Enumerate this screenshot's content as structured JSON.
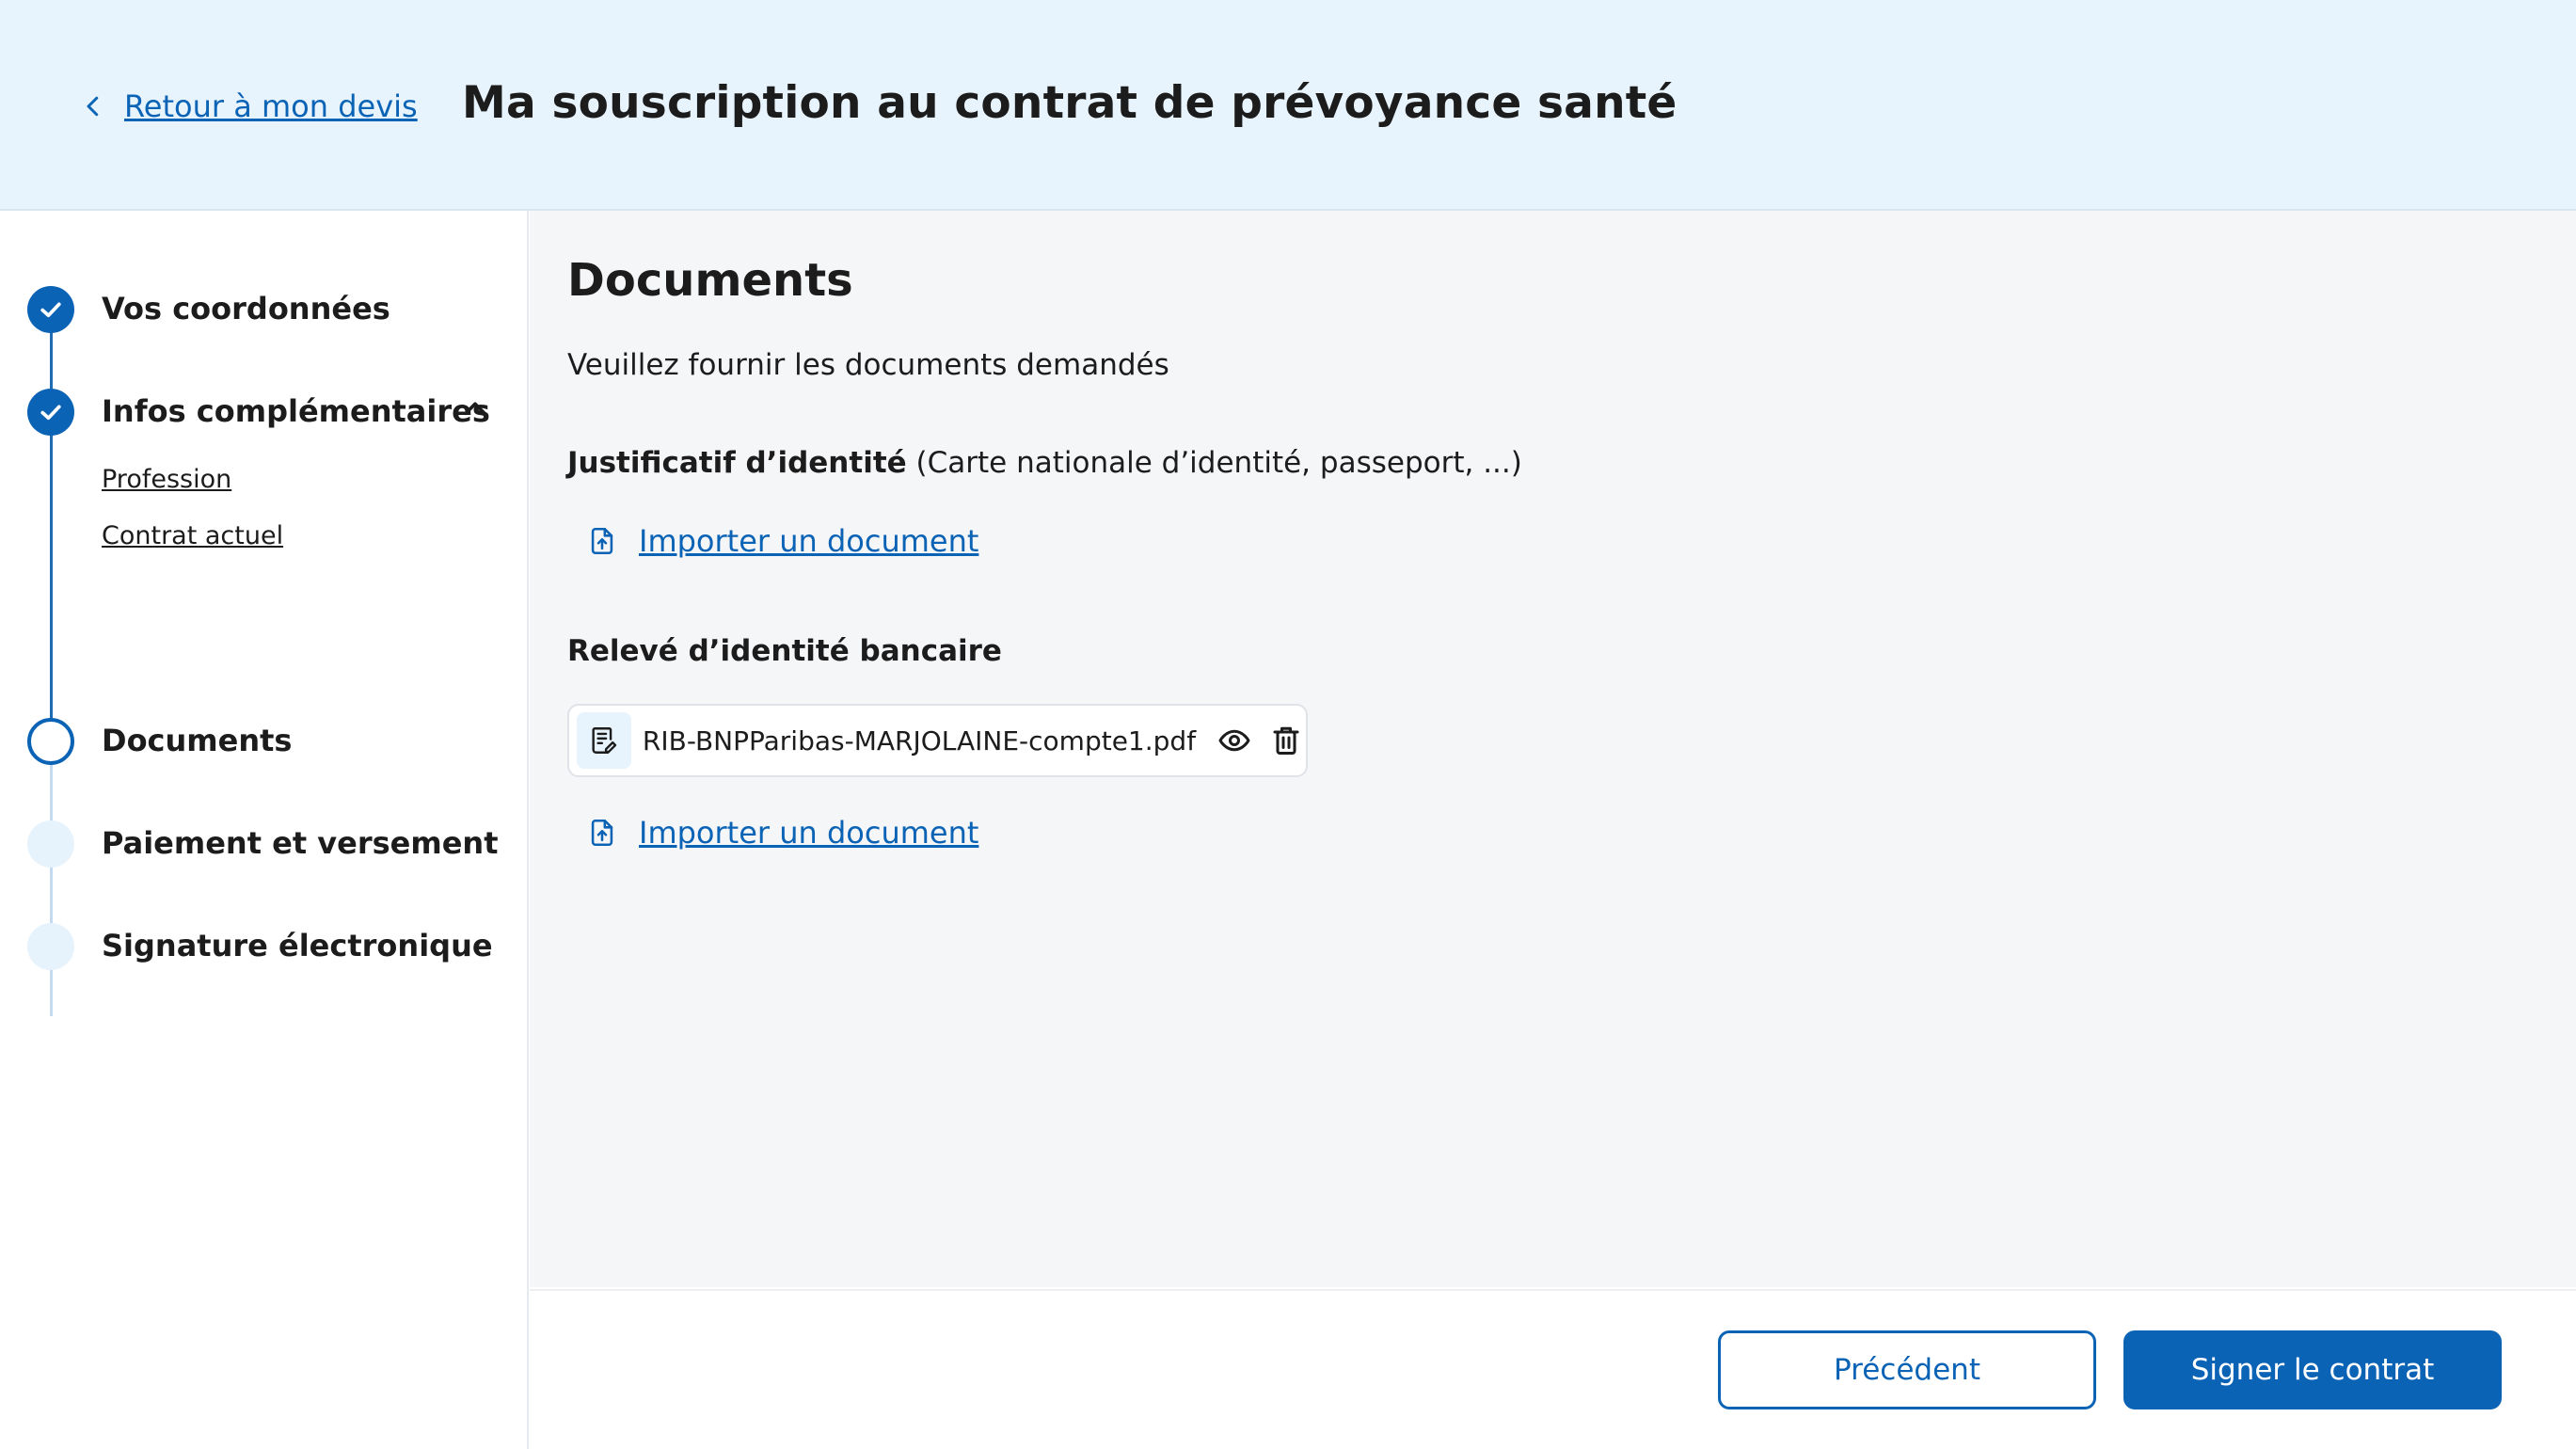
{
  "header": {
    "back_label": "Retour à mon devis",
    "title": "Ma souscription au contrat de prévoyance santé"
  },
  "steps": [
    {
      "label": "Vos coordonnées",
      "status": "done"
    },
    {
      "label": "Infos complémentaires",
      "status": "done",
      "expanded": true,
      "substeps": [
        {
          "label": "Profession"
        },
        {
          "label": "Contrat actuel"
        }
      ]
    },
    {
      "label": "Documents",
      "status": "current"
    },
    {
      "label": "Paiement et versement",
      "status": "todo"
    },
    {
      "label": "Signature électronique",
      "status": "todo"
    }
  ],
  "main": {
    "title": "Documents",
    "intro": "Veuillez fournir les documents demandés",
    "identity": {
      "label_bold": "Justificatif d’identité",
      "label_rest": " (Carte nationale d’identité, passeport, ...)",
      "import_label": "Importer un document"
    },
    "bank": {
      "label": "Relevé d’identité bancaire",
      "file_name": "RIB-BNPParibas-MARJOLAINE-compte1.pdf",
      "import_label": "Importer un document"
    }
  },
  "footer": {
    "prev_label": "Précédent",
    "sign_label": "Signer le contrat"
  },
  "colors": {
    "primary": "#0b63b6",
    "header_bg": "#e8f4fd",
    "main_bg": "#f5f6f8",
    "todo_dot": "#e6f2fc"
  }
}
